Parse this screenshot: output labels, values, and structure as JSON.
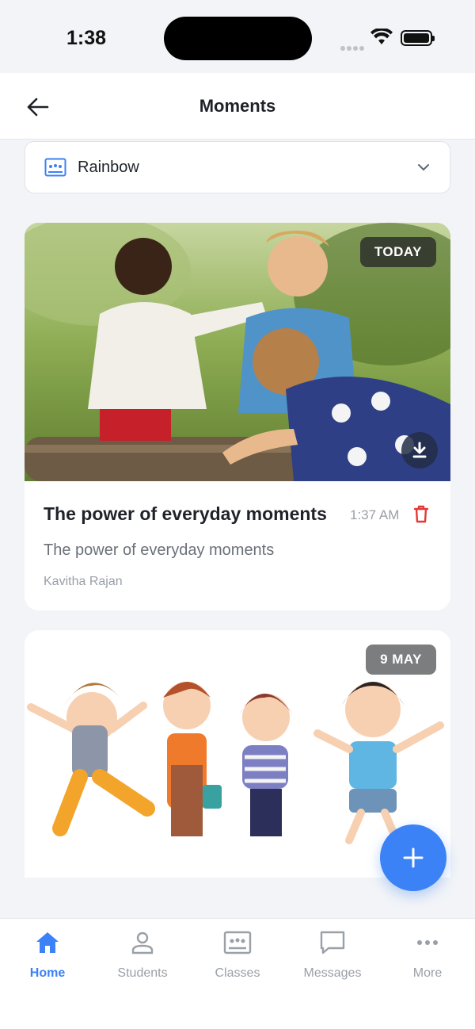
{
  "status_bar": {
    "time": "1:38"
  },
  "header": {
    "title": "Moments",
    "back_icon": "arrow-left-icon"
  },
  "class_selector": {
    "selected": "Rainbow",
    "icon": "classroom-icon"
  },
  "posts": [
    {
      "badge": "TODAY",
      "title": "The power of everyday moments",
      "time": "1:37 AM",
      "description": "The power of everyday moments",
      "author": "Kavitha Rajan"
    },
    {
      "badge": "9 MAY"
    }
  ],
  "fab": {
    "icon": "plus-icon"
  },
  "bottom_nav": {
    "items": [
      {
        "label": "Home",
        "icon": "home-icon",
        "active": true
      },
      {
        "label": "Students",
        "icon": "person-icon",
        "active": false
      },
      {
        "label": "Classes",
        "icon": "classroom-icon",
        "active": false
      },
      {
        "label": "Messages",
        "icon": "chat-icon",
        "active": false
      },
      {
        "label": "More",
        "icon": "more-icon",
        "active": false
      }
    ]
  },
  "colors": {
    "accent": "#3b82f6",
    "delete": "#e53935",
    "background": "#f2f4f7"
  }
}
